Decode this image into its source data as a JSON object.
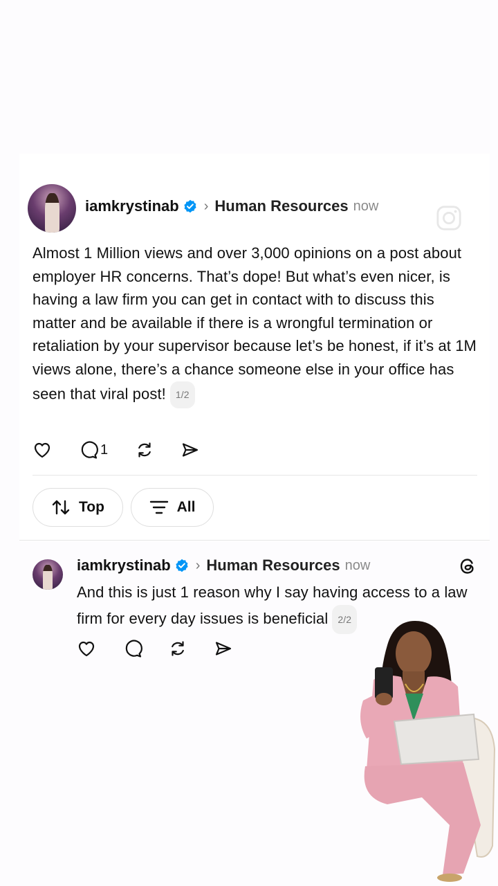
{
  "post1": {
    "username": "iamkrystinab",
    "topic": "Human Resources",
    "time": "now",
    "text": "Almost 1 Million views and over 3,000 opinions on a post about employer HR concerns. That’s dope! But what’s even nicer, is having a law firm you can get in contact with to discuss this matter and be available if there is a wrongful termination or retaliation by your supervisor because let’s be honest, if it’s at 1M views alone, there’s a chance someone else in your office has seen that viral post!",
    "page_badge": "1/2",
    "reply_count": "1"
  },
  "sort": {
    "top_label": "Top",
    "all_label": "All"
  },
  "post2": {
    "username": "iamkrystinab",
    "topic": "Human Resources",
    "time": "now",
    "text": "And this is just 1 reason why I say having access to a law firm for every day issues is beneficial",
    "page_badge": "2/2"
  },
  "icons": {
    "verified": "verified-badge-icon",
    "like": "heart-icon",
    "reply": "comment-icon",
    "repost": "repost-icon",
    "share": "send-icon",
    "sort": "sort-arrows-icon",
    "filter": "filter-lines-icon",
    "threads": "threads-logo-icon",
    "instagram": "instagram-watermark-icon"
  },
  "colors": {
    "verified": "#0095f6",
    "background": "#fdfcfe",
    "muted_text": "#8a8a8a"
  }
}
